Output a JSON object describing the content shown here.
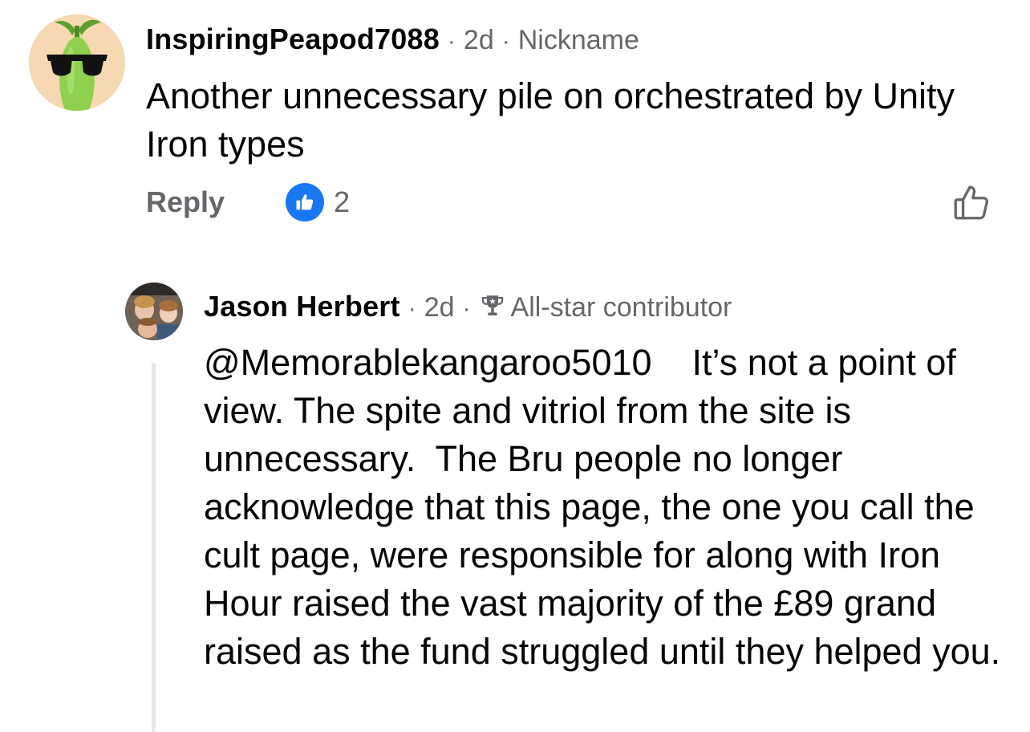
{
  "comment": {
    "author": "InspiringPeapod7088",
    "age": "2d",
    "badge": "Nickname",
    "text": "Another unnecessary pile on orchestrated by Unity Iron types",
    "reply_label": "Reply",
    "reaction_count": "2",
    "reaction_icon": "thumbs-up-icon",
    "like_icon": "thumbs-up-outline-icon"
  },
  "reply": {
    "author": "Jason Herbert",
    "age": "2d",
    "badge_icon": "trophy-icon",
    "badge": "All-star contributor",
    "mention": "@Memorablekangaroo5010",
    "text": "It’s not a point of view. The spite and vitriol from the site is unnecessary.  The Bru people no longer acknowledge that this page, the one you call the cult page, were responsible for along with Iron Hour raised the vast majority of the £89 grand raised as the fund struggled until they helped you."
  },
  "colors": {
    "accent": "#1877f2",
    "secondary_text": "#65676b",
    "primary_text": "#050505",
    "thread_line": "#e4e6eb"
  },
  "separator": "·"
}
